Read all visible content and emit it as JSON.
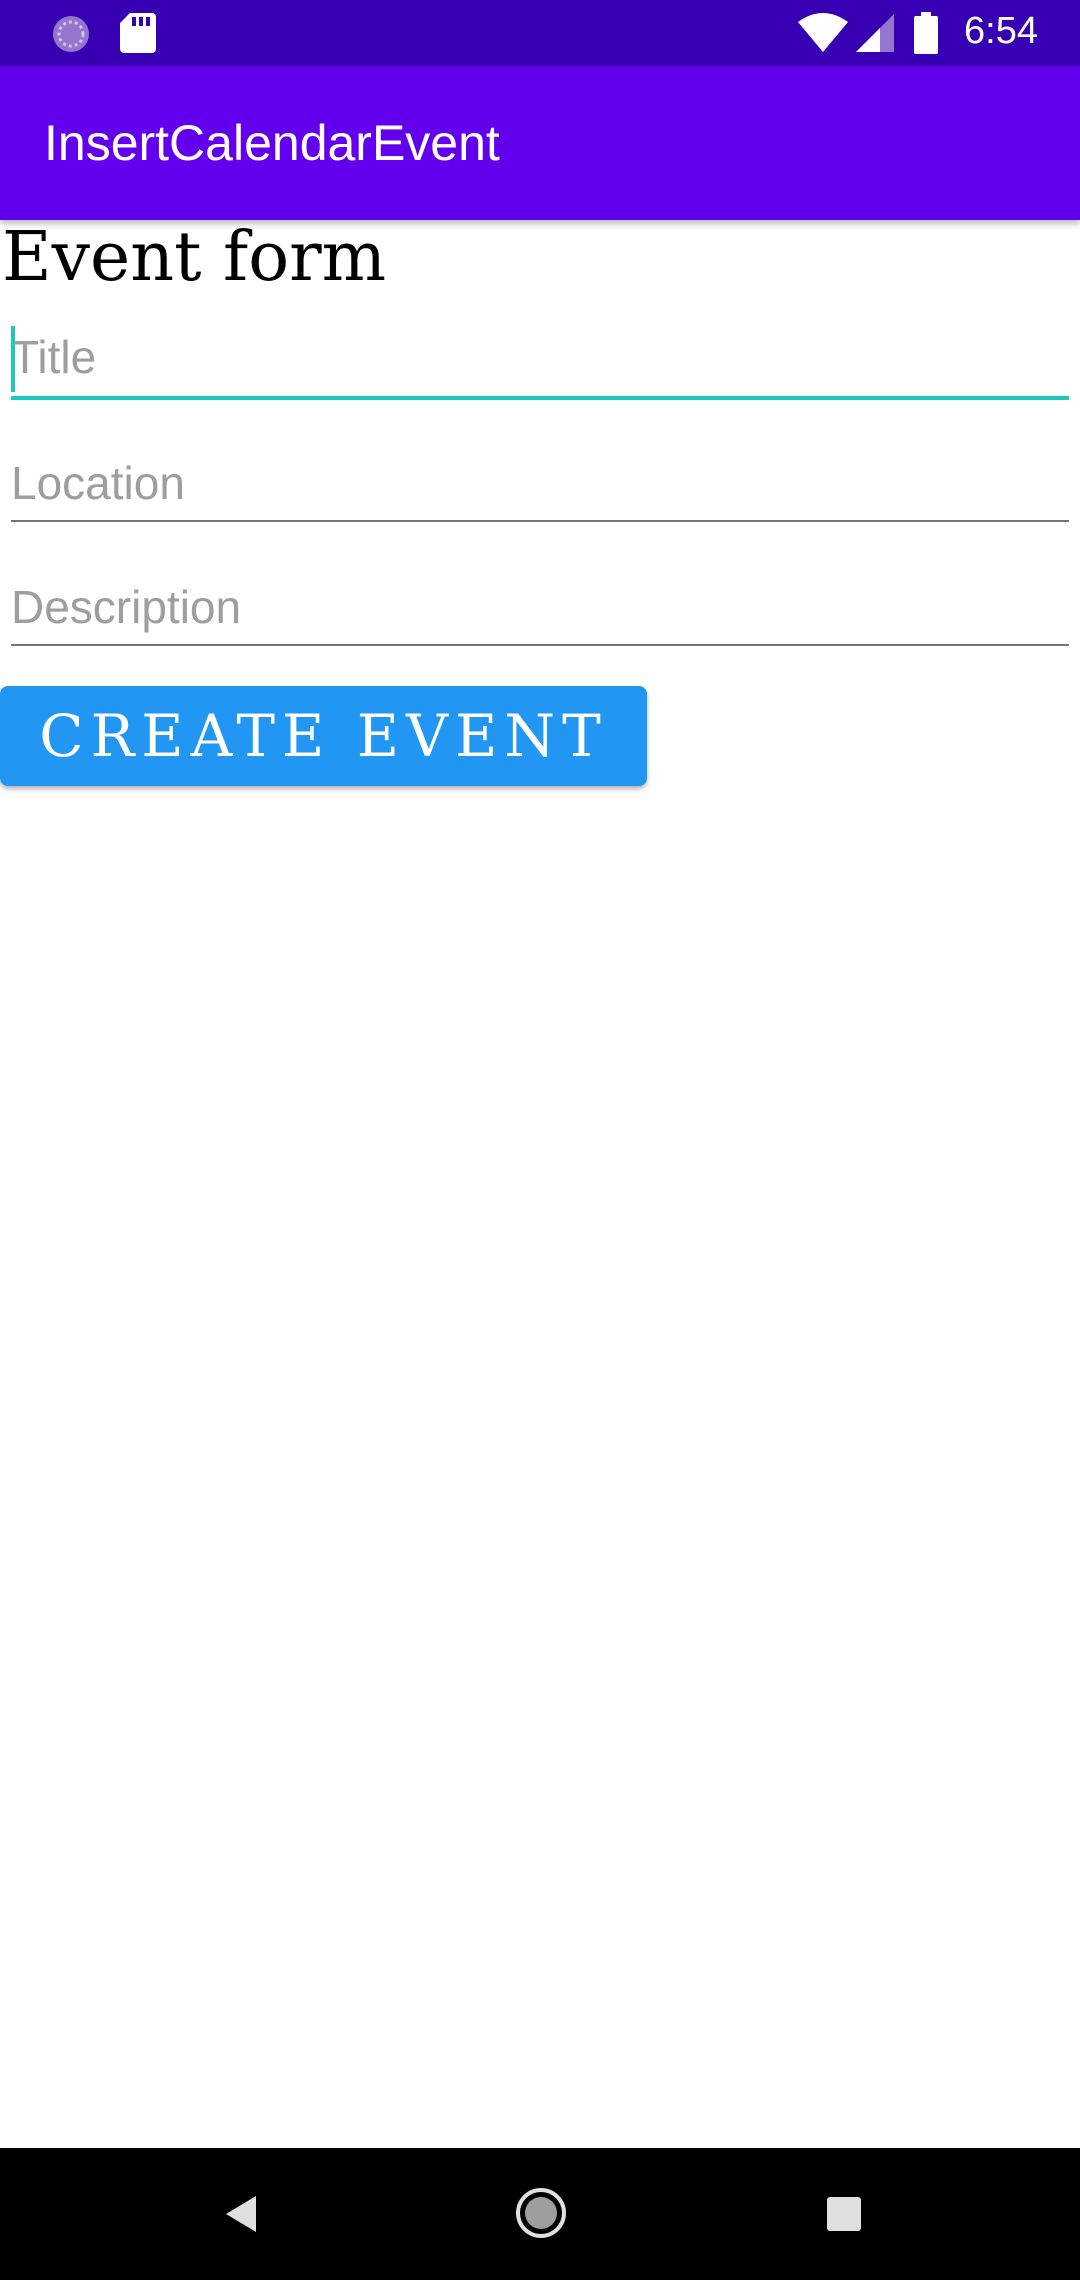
{
  "status_bar": {
    "time": "6:54",
    "icons": [
      "sync-icon",
      "sd-card-icon",
      "wifi-icon",
      "signal-icon",
      "battery-icon"
    ]
  },
  "app_bar": {
    "title": "InsertCalendarEvent"
  },
  "form": {
    "heading": "Event form",
    "title_field": {
      "placeholder": "Title",
      "value": ""
    },
    "location_field": {
      "placeholder": "Location",
      "value": ""
    },
    "description_field": {
      "placeholder": "Description",
      "value": ""
    },
    "create_button_label": "CREATE EVENT"
  },
  "nav_bar": {
    "icons": [
      "back-icon",
      "home-icon",
      "recents-icon"
    ]
  },
  "colors": {
    "status_bar": "#3700b3",
    "app_bar": "#6200ee",
    "accent": "#1ec8c0",
    "button": "#2196f3"
  }
}
